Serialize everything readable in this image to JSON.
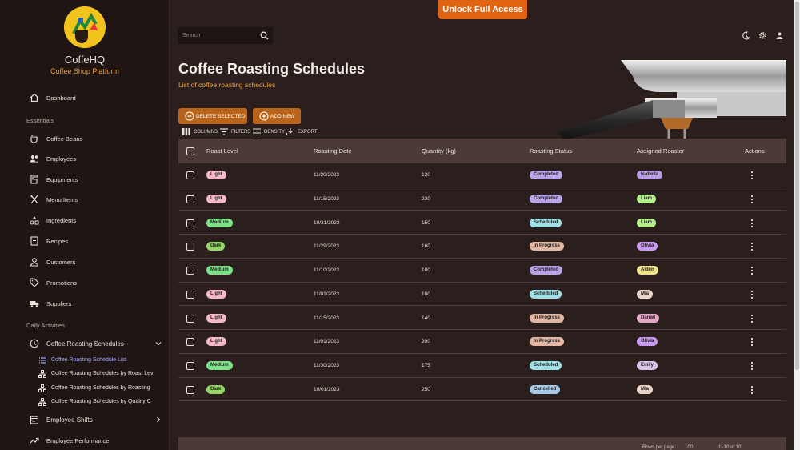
{
  "brand": {
    "title": "CoffeHQ",
    "subtitle": "Coffee Shop Platform"
  },
  "top": {
    "unlock_label": "Unlock Full Access",
    "search_placeholder": "Search"
  },
  "page": {
    "title": "Coffee Roasting Schedules",
    "subtitle": "List of coffee roasting schedules"
  },
  "sidebar": {
    "dashboard": "Dashboard",
    "essentials_label": "Essentials",
    "essentials": [
      "Coffee Beans",
      "Employees",
      "Equipments",
      "Menu Items",
      "Ingredients",
      "Recipes",
      "Customers",
      "Promotions",
      "Suppliers"
    ],
    "daily_label": "Daily Activities",
    "roasting": "Coffee Roasting Schedules",
    "roasting_sub": [
      "Coffee Roasting Schedule List",
      "Coffee Roasting Schedules by Roast Lev",
      "Coffee Roasting Schedules by Roasting",
      "Coffee Roasting Schedules by Quality C"
    ],
    "shifts": "Employee Shifts",
    "performance": "Employee Performance"
  },
  "toolbar": {
    "delete_label": "DELETE SELECTED",
    "add_label": "ADD NEW",
    "columns": "COLUMNS",
    "filters": "FILTERS",
    "density": "DENSITY",
    "export": "EXPORT"
  },
  "table": {
    "columns": [
      "Roast Level",
      "Roasting Date",
      "Quantity (kg)",
      "Roasting Status",
      "Assigned Roaster",
      "Actions"
    ],
    "rows": [
      {
        "roast": "Light",
        "date": "11/20/2023",
        "qty": "120",
        "status": "Completed",
        "roaster": "Isabella"
      },
      {
        "roast": "Light",
        "date": "11/15/2023",
        "qty": "220",
        "status": "Completed",
        "roaster": "Liam"
      },
      {
        "roast": "Medium",
        "date": "10/31/2023",
        "qty": "150",
        "status": "Scheduled",
        "roaster": "Liam"
      },
      {
        "roast": "Dark",
        "date": "11/29/2023",
        "qty": "160",
        "status": "In Progress",
        "roaster": "Olivia"
      },
      {
        "roast": "Medium",
        "date": "11/10/2023",
        "qty": "180",
        "status": "Completed",
        "roaster": "Aiden"
      },
      {
        "roast": "Light",
        "date": "11/01/2023",
        "qty": "180",
        "status": "Scheduled",
        "roaster": "Mia"
      },
      {
        "roast": "Light",
        "date": "11/15/2023",
        "qty": "140",
        "status": "In Progress",
        "roaster": "Daniel"
      },
      {
        "roast": "Light",
        "date": "11/01/2023",
        "qty": "200",
        "status": "In Progress",
        "roaster": "Olivia"
      },
      {
        "roast": "Medium",
        "date": "11/30/2023",
        "qty": "175",
        "status": "Scheduled",
        "roaster": "Emily"
      },
      {
        "roast": "Dark",
        "date": "10/01/2023",
        "qty": "250",
        "status": "Cancelled",
        "roaster": "Mia"
      }
    ],
    "footer": {
      "rows_per_page_label": "Rows per page:",
      "rows_per_page": "100",
      "range": "1–10 of 10"
    }
  },
  "colors": {
    "roast": {
      "Light": "#f6b9c8",
      "Medium": "#7fe08a",
      "Dark": "#96d36a"
    },
    "status": {
      "Completed": "#b9a4e8",
      "Scheduled": "#9fe0e6",
      "In Progress": "#e2b7a3",
      "Cancelled": "#a9c9e8"
    },
    "roaster": {
      "Isabella": "#b79be4",
      "Liam": "#b6f08c",
      "Olivia": "#c99af0",
      "Aiden": "#eee28a",
      "Mia": "#ecd5cb",
      "Daniel": "#e7a7c6",
      "Emily": "#d6c3e6"
    },
    "accent": "#e06412"
  }
}
